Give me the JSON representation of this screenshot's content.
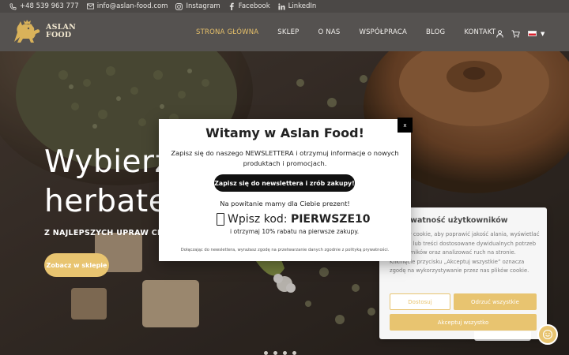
{
  "topbar": {
    "phone": "+48 539 963 777",
    "email": "info@aslan-food.com",
    "instagram": "Instagram",
    "facebook": "Facebook",
    "linkedin": "LinkedIn"
  },
  "logo": {
    "line1": "ASLAN",
    "line2": "FOOD"
  },
  "nav": {
    "items": [
      "STRONA GŁÓWNA",
      "SKLEP",
      "O NAS",
      "WSPÓŁPRACA",
      "BLOG",
      "KONTAKT"
    ],
    "active_index": 0
  },
  "hero": {
    "title_line1": "Wybierz",
    "title_line2": "herbatę",
    "subtitle": "Z NAJLEPSZYCH UPRAW CEYLO",
    "button": "Zobacz w sklepie"
  },
  "modal": {
    "close": "x",
    "title": "Witamy w Aslan Food!",
    "text": "Zapisz się do naszego NEWSLETTERA i otrzymuj informacje o nowych produktach i promocjach.",
    "button": "Zapisz się do newslettera i zrób zakupy!",
    "welcome": "Na powitanie mamy dla Ciebie prezent!",
    "code_prefix": "Wpisz kod: ",
    "code": "PIERWSZE10",
    "code_sub": "i otrzymaj 10% rabatu na pierwsze zakupy.",
    "consent": "Dołączając do newslettera, wyrażasz zgodę na przetwarzanie danych zgodnie z polityką prywatności."
  },
  "cookie": {
    "title": "y prywatność użytkowników",
    "text": "y plików cookie, aby poprawić jakość alania, wyświetlać reklamy lub treści dostosowane dywidualnych potrzeb użytkowników oraz analizować ruch na stronie. Kliknięcie przycisku „Akceptuj wszystkie” oznacza zgodę na wykorzystywanie przez nas plików cookie.",
    "btn_customize": "Dostosuj",
    "btn_reject": "Odrzuć wszystkie",
    "btn_accept": "Akceptuj wszystko"
  },
  "colors": {
    "accent": "#e8c470",
    "nav_bg": "#555250",
    "topbar_bg": "#4b4846",
    "active_nav": "#e6c06a"
  },
  "icons": [
    "phone-icon",
    "mail-icon",
    "instagram-icon",
    "facebook-icon",
    "linkedin-icon",
    "user-icon",
    "cart-icon",
    "flag-pl-icon",
    "chevron-down-icon",
    "gift-icon",
    "chat-icon"
  ]
}
